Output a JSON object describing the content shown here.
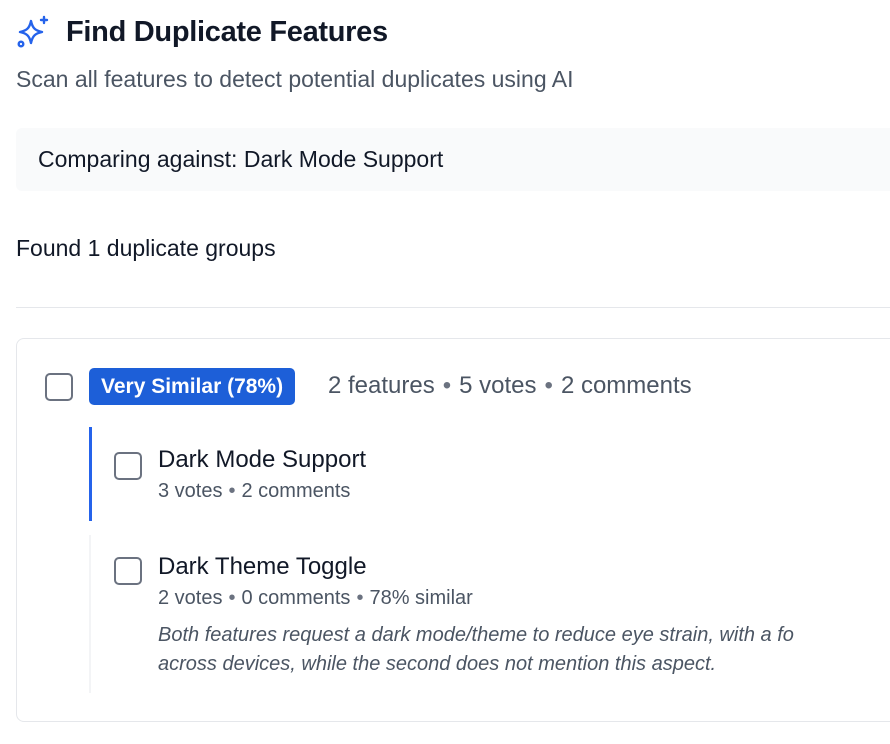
{
  "header": {
    "icon": "sparkles-icon",
    "title": "Find Duplicate Features",
    "subtitle": "Scan all features to detect potential duplicates using AI"
  },
  "comparing": {
    "text": "Comparing against: Dark Mode Support"
  },
  "results": {
    "summary": "Found 1 duplicate groups"
  },
  "group": {
    "badge": "Very Similar (78%)",
    "features_count": "2 features",
    "votes": "5 votes",
    "comments": "2 comments",
    "separator": "•",
    "features": [
      {
        "title": "Dark Mode Support",
        "votes": "3 votes",
        "comments": "2 comments"
      },
      {
        "title": "Dark Theme Toggle",
        "votes": "2 votes",
        "comments": "0 comments",
        "similarity": "78% similar",
        "explanation_line1": "Both features request a dark mode/theme to reduce eye strain, with a fo",
        "explanation_line2": "across devices, while the second does not mention this aspect."
      }
    ]
  },
  "colors": {
    "accent": "#1d5fd8",
    "selected_border": "#2563eb",
    "muted_text": "#4b5563",
    "panel_bg": "#f9fafb"
  }
}
